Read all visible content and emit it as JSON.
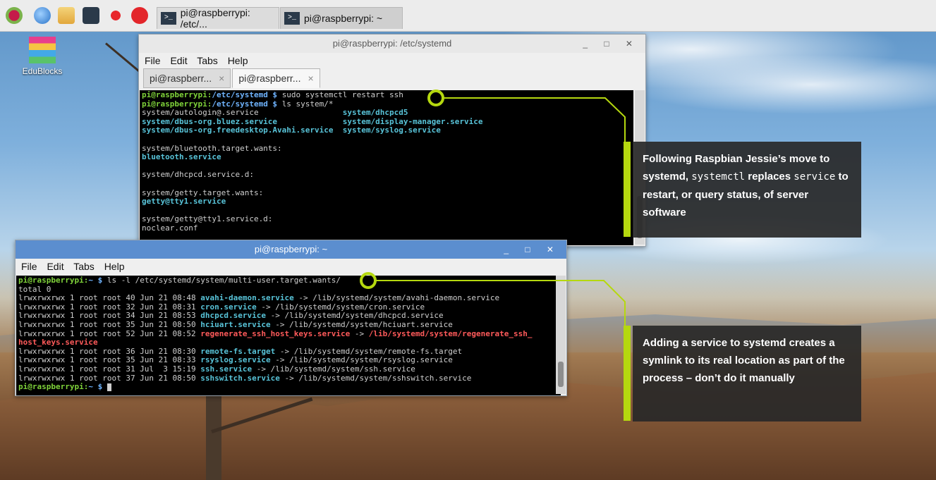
{
  "desktop": {
    "icon_label": "EduBlocks"
  },
  "taskbar": {
    "tasks": [
      {
        "label": "pi@raspberrypi: /etc/..."
      },
      {
        "label": "pi@raspberrypi: ~"
      }
    ]
  },
  "window1": {
    "title": "pi@raspberrypi: /etc/systemd",
    "menu": [
      "File",
      "Edit",
      "Tabs",
      "Help"
    ],
    "tabs": [
      {
        "label": "pi@raspberr..."
      },
      {
        "label": "pi@raspberr..."
      }
    ],
    "close_glyph": "×",
    "lines": [
      [
        {
          "t": "pi@raspberrypi:",
          "c": "g"
        },
        {
          "t": "/etc/systemd $ ",
          "c": "b"
        },
        {
          "t": "sudo systemctl restart ssh",
          "c": ""
        }
      ],
      [
        {
          "t": "pi@raspberrypi:",
          "c": "g"
        },
        {
          "t": "/etc/systemd $ ",
          "c": "b"
        },
        {
          "t": "ls system/*",
          "c": ""
        }
      ],
      [
        {
          "t": "system/autologin@.service                  ",
          "c": ""
        },
        {
          "t": "system/dhcpcd5",
          "c": "cy"
        }
      ],
      [
        {
          "t": "system/dbus-org.bluez.service              ",
          "c": "cy"
        },
        {
          "t": "system/display-manager.service",
          "c": "cy"
        }
      ],
      [
        {
          "t": "system/dbus-org.freedesktop.Avahi.service  ",
          "c": "cy"
        },
        {
          "t": "system/syslog.service",
          "c": "cy"
        }
      ],
      [
        {
          "t": "",
          "c": ""
        }
      ],
      [
        {
          "t": "system/bluetooth.target.wants:",
          "c": ""
        }
      ],
      [
        {
          "t": "bluetooth.service",
          "c": "cy"
        }
      ],
      [
        {
          "t": "",
          "c": ""
        }
      ],
      [
        {
          "t": "system/dhcpcd.service.d:",
          "c": ""
        }
      ],
      [
        {
          "t": "",
          "c": ""
        }
      ],
      [
        {
          "t": "system/getty.target.wants:",
          "c": ""
        }
      ],
      [
        {
          "t": "getty@tty1.service",
          "c": "cy"
        }
      ],
      [
        {
          "t": "",
          "c": ""
        }
      ],
      [
        {
          "t": "system/getty@tty1.service.d:",
          "c": ""
        }
      ],
      [
        {
          "t": "noclear.conf",
          "c": ""
        }
      ]
    ]
  },
  "window2": {
    "title": "pi@raspberrypi: ~",
    "menu": [
      "File",
      "Edit",
      "Tabs",
      "Help"
    ],
    "lines": [
      [
        {
          "t": "pi@raspberrypi:",
          "c": "g"
        },
        {
          "t": "~ $ ",
          "c": "b"
        },
        {
          "t": "ls -l /etc/systemd/system/multi-user.target.wants/",
          "c": ""
        }
      ],
      [
        {
          "t": "total 0",
          "c": ""
        }
      ],
      [
        {
          "t": "lrwxrwxrwx 1 root root 40 Jun 21 08:48 ",
          "c": ""
        },
        {
          "t": "avahi-daemon.service",
          "c": "cy"
        },
        {
          "t": " -> /lib/systemd/system/avahi-daemon.service",
          "c": ""
        }
      ],
      [
        {
          "t": "lrwxrwxrwx 1 root root 32 Jun 21 08:31 ",
          "c": ""
        },
        {
          "t": "cron.service",
          "c": "cy"
        },
        {
          "t": " -> /lib/systemd/system/cron.service",
          "c": ""
        }
      ],
      [
        {
          "t": "lrwxrwxrwx 1 root root 34 Jun 21 08:53 ",
          "c": ""
        },
        {
          "t": "dhcpcd.service",
          "c": "cy"
        },
        {
          "t": " -> /lib/systemd/system/dhcpcd.service",
          "c": ""
        }
      ],
      [
        {
          "t": "lrwxrwxrwx 1 root root 35 Jun 21 08:50 ",
          "c": ""
        },
        {
          "t": "hciuart.service",
          "c": "cy"
        },
        {
          "t": " -> /lib/systemd/system/hciuart.service",
          "c": ""
        }
      ],
      [
        {
          "t": "lrwxrwxrwx 1 root root 52 Jun 21 08:52 ",
          "c": ""
        },
        {
          "t": "regenerate_ssh_host_keys.service",
          "c": "r"
        },
        {
          "t": " -> ",
          "c": ""
        },
        {
          "t": "/lib/systemd/system/regenerate_ssh_",
          "c": "r"
        }
      ],
      [
        {
          "t": "host_keys.service",
          "c": "r"
        }
      ],
      [
        {
          "t": "lrwxrwxrwx 1 root root 36 Jun 21 08:30 ",
          "c": ""
        },
        {
          "t": "remote-fs.target",
          "c": "cy"
        },
        {
          "t": " -> /lib/systemd/system/remote-fs.target",
          "c": ""
        }
      ],
      [
        {
          "t": "lrwxrwxrwx 1 root root 35 Jun 21 08:33 ",
          "c": ""
        },
        {
          "t": "rsyslog.service",
          "c": "cy"
        },
        {
          "t": " -> /lib/systemd/system/rsyslog.service",
          "c": ""
        }
      ],
      [
        {
          "t": "lrwxrwxrwx 1 root root 31 Jul  3 15:19 ",
          "c": ""
        },
        {
          "t": "ssh.service",
          "c": "cy"
        },
        {
          "t": " -> /lib/systemd/system/ssh.service",
          "c": ""
        }
      ],
      [
        {
          "t": "lrwxrwxrwx 1 root root 37 Jun 21 08:50 ",
          "c": ""
        },
        {
          "t": "sshswitch.service",
          "c": "cy"
        },
        {
          "t": " -> /lib/systemd/system/sshswitch.service",
          "c": ""
        }
      ],
      [
        {
          "t": "pi@raspberrypi:",
          "c": "g"
        },
        {
          "t": "~ $ ",
          "c": "b"
        }
      ]
    ]
  },
  "callouts": {
    "a": {
      "pre": "Following Raspbian Jessie’s move to systemd, ",
      "code1": "systemctl",
      "mid": " replaces ",
      "code2": "service",
      "post": " to restart, or query status, of server software"
    },
    "b": {
      "text": "Adding a service to systemd creates a symlink to its real location as part of the process – don’t do it manually"
    }
  },
  "colors": {
    "accent": "#b5d80f",
    "prompt_user": "#7fd23a",
    "prompt_path": "#6fb4ff",
    "link": "#58c3d8",
    "broken_link": "#ff5a5a"
  }
}
